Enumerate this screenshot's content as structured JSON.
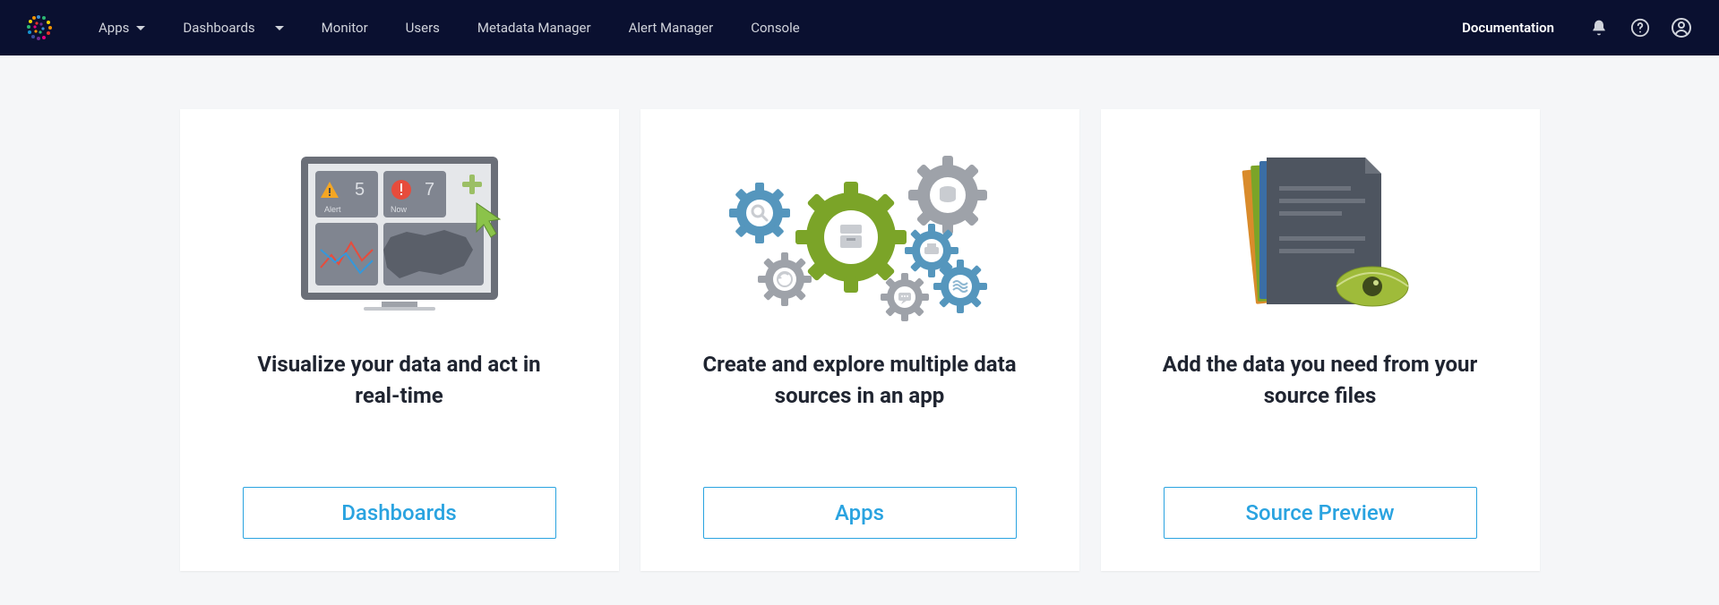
{
  "nav": {
    "items": [
      {
        "label": "Apps",
        "hasCaret": true
      },
      {
        "label": "Dashboards",
        "hasCaret": true
      },
      {
        "label": "Monitor",
        "hasCaret": false
      },
      {
        "label": "Users",
        "hasCaret": false
      },
      {
        "label": "Metadata Manager",
        "hasCaret": false
      },
      {
        "label": "Alert Manager",
        "hasCaret": false
      },
      {
        "label": "Console",
        "hasCaret": false
      }
    ],
    "documentation": "Documentation"
  },
  "cards": [
    {
      "title": "Visualize your data and act in real-time",
      "button": "Dashboards",
      "illus_alert_number": "5",
      "illus_now_number": "7",
      "illus_alert_label": "Alert",
      "illus_now_label": "Now"
    },
    {
      "title": "Create and explore multiple data sources in an app",
      "button": "Apps"
    },
    {
      "title": "Add the data you need from your source files",
      "button": "Source Preview"
    }
  ]
}
